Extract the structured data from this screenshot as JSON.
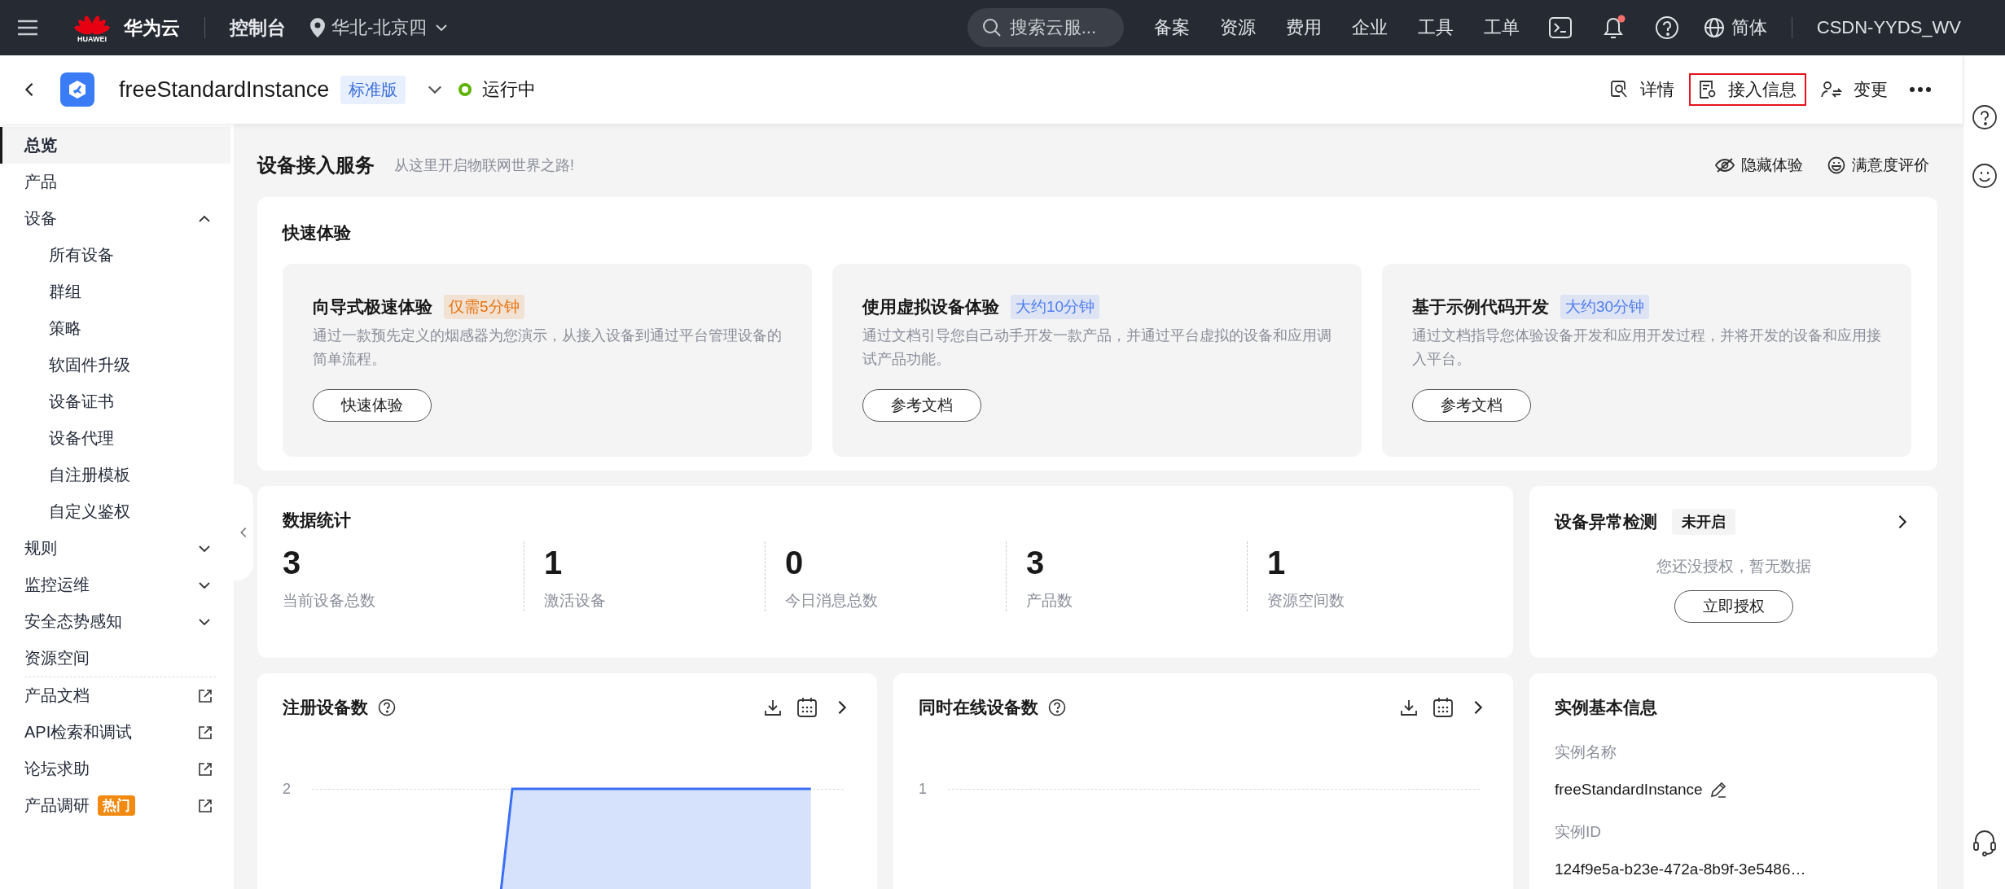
{
  "top_bar": {
    "logo_caption": "HUAWEI",
    "brand": "华为云",
    "console": "控制台",
    "region": "华北-北京四",
    "search": {
      "placeholder": "搜索云服..."
    },
    "nav": [
      "备案",
      "资源",
      "费用",
      "企业",
      "工具",
      "工单"
    ],
    "has_unread_notifications": true,
    "language": "简体",
    "account": "CSDN-YYDS_WV"
  },
  "header": {
    "instance_name": "freeStandardInstance",
    "edition": "标准版",
    "status": "运行中",
    "actions": [
      {
        "kind": "details",
        "label": "详情",
        "highlighted": false
      },
      {
        "kind": "access",
        "label": "接入信息",
        "highlighted": true
      },
      {
        "kind": "change",
        "label": "变更",
        "highlighted": false
      }
    ]
  },
  "sidebar": {
    "items": [
      {
        "kind": "page",
        "label": "总览",
        "selected": true
      },
      {
        "kind": "page",
        "label": "产品",
        "selected": false
      },
      {
        "kind": "group",
        "label": "设备",
        "selected": false,
        "expanded": true,
        "children": [
          {
            "label": "所有设备",
            "selected": false
          },
          {
            "label": "群组",
            "selected": false
          },
          {
            "label": "策略",
            "selected": false
          },
          {
            "label": "软固件升级",
            "selected": false
          },
          {
            "label": "设备证书",
            "selected": false
          },
          {
            "label": "设备代理",
            "selected": false
          },
          {
            "label": "自注册模板",
            "selected": false
          },
          {
            "label": "自定义鉴权",
            "selected": false
          }
        ]
      },
      {
        "kind": "group",
        "label": "规则",
        "selected": false,
        "expanded": false
      },
      {
        "kind": "group",
        "label": "监控运维",
        "selected": false,
        "expanded": false
      },
      {
        "kind": "group",
        "label": "安全态势感知",
        "selected": false,
        "expanded": false
      },
      {
        "kind": "page",
        "label": "资源空间",
        "selected": false
      }
    ],
    "links": [
      {
        "label": "产品文档"
      },
      {
        "label": "API检索和调试"
      },
      {
        "label": "论坛求助"
      },
      {
        "label": "产品调研",
        "badge": "热门"
      }
    ]
  },
  "overview": {
    "title": "设备接入服务",
    "subtitle": "从这里开启物联网世界之路!",
    "actions": [
      {
        "kind": "hide",
        "label": "隐藏体验"
      },
      {
        "kind": "rate",
        "label": "满意度评价"
      }
    ],
    "quick_start": {
      "title": "快速体验",
      "cards": [
        {
          "title": "向导式极速体验",
          "tag": "仅需5分钟",
          "color": "#e8710a",
          "description": "通过一款预先定义的烟感器为您演示，从接入设备到通过平台管理设备的简单流程。",
          "button": "快速体验"
        },
        {
          "title": "使用虚拟设备体验",
          "tag": "大约10分钟",
          "color": "#4f7df0",
          "description": "通过文档引导您自己动手开发一款产品，并通过平台虚拟的设备和应用调试产品功能。",
          "button": "参考文档"
        },
        {
          "title": "基于示例代码开发",
          "tag": "大约30分钟",
          "color": "#4f7df0",
          "description": "通过文档指导您体验设备开发和应用开发过程，并将开发的设备和应用接入平台。",
          "button": "参考文档"
        }
      ]
    },
    "stats": {
      "title": "数据统计",
      "items": [
        {
          "value": "3",
          "label": "当前设备总数"
        },
        {
          "value": "1",
          "label": "激活设备"
        },
        {
          "value": "0",
          "label": "今日消息总数"
        },
        {
          "value": "3",
          "label": "产品数"
        },
        {
          "value": "1",
          "label": "资源空间数"
        }
      ]
    },
    "anomaly": {
      "title": "设备异常检测",
      "status": "未开启",
      "message": "您还没授权，暂无数据",
      "button": "立即授权"
    },
    "charts": [
      {
        "title": "注册设备数",
        "axis_label": "2",
        "line_visible": true
      },
      {
        "title": "同时在线设备数",
        "axis_label": "1",
        "line_visible": false
      }
    ],
    "instance_info": {
      "title": "实例基本信息",
      "fields": [
        {
          "label": "实例名称",
          "value": "freeStandardInstance",
          "editable": true
        },
        {
          "label": "实例ID",
          "value": "124f9e5a-b23e-472a-8b9f-3e5486…",
          "editable": false
        }
      ]
    }
  }
}
